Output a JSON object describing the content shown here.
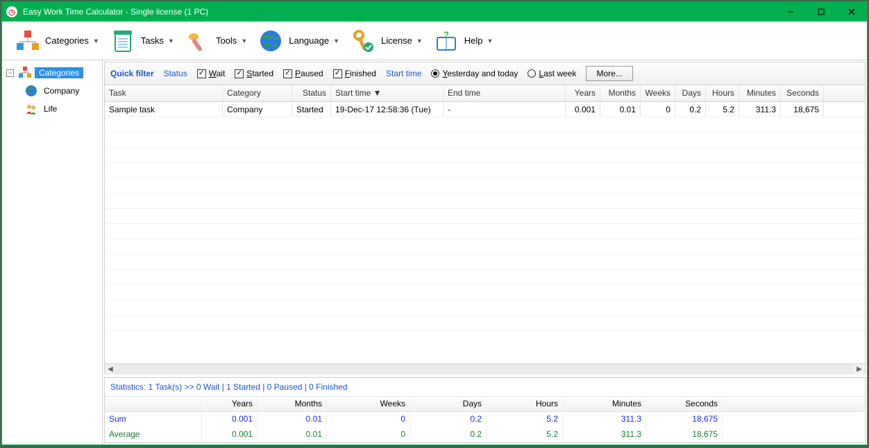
{
  "title": "Easy Work Time Calculator - Single license (1 PC)",
  "toolbar": {
    "categories": "Categories",
    "tasks": "Tasks",
    "tools": "Tools",
    "language": "Language",
    "license": "License",
    "help": "Help"
  },
  "sidebar": {
    "root": "Categories",
    "items": [
      "Company",
      "Life"
    ]
  },
  "filter": {
    "quick": "Quick filter",
    "status": "Status",
    "wait": "Wait",
    "started": "Started",
    "paused": "Paused",
    "finished": "Finished",
    "starttime": "Start time",
    "opt_yt": "Yesterday and today",
    "opt_lw": "Last week",
    "more": "More..."
  },
  "grid": {
    "headers": {
      "task": "Task",
      "category": "Category",
      "status": "Status",
      "start": "Start time ▼",
      "end": "End time",
      "years": "Years",
      "months": "Months",
      "weeks": "Weeks",
      "days": "Days",
      "hours": "Hours",
      "minutes": "Minutes",
      "seconds": "Seconds"
    },
    "rows": [
      {
        "task": "Sample task",
        "category": "Company",
        "status": "Started",
        "start": "19-Dec-17 12:58:36 (Tue)",
        "end": "-",
        "years": "0.001",
        "months": "0.01",
        "weeks": "0",
        "days": "0.2",
        "hours": "5.2",
        "minutes": "311.3",
        "seconds": "18,675"
      }
    ]
  },
  "stats": {
    "line": "Statistics: 1 Task(s) >> 0 Wait | 1 Started | 0 Paused | 0 Finished",
    "headers": {
      "years": "Years",
      "months": "Months",
      "weeks": "Weeks",
      "days": "Days",
      "hours": "Hours",
      "minutes": "Minutes",
      "seconds": "Seconds"
    },
    "sum_label": "Sum",
    "avg_label": "Average",
    "sum": {
      "years": "0.001",
      "months": "0.01",
      "weeks": "0",
      "days": "0.2",
      "hours": "5.2",
      "minutes": "311.3",
      "seconds": "18,675"
    },
    "avg": {
      "years": "0.001",
      "months": "0.01",
      "weeks": "0",
      "days": "0.2",
      "hours": "5.2",
      "minutes": "311.3",
      "seconds": "18,675"
    }
  }
}
